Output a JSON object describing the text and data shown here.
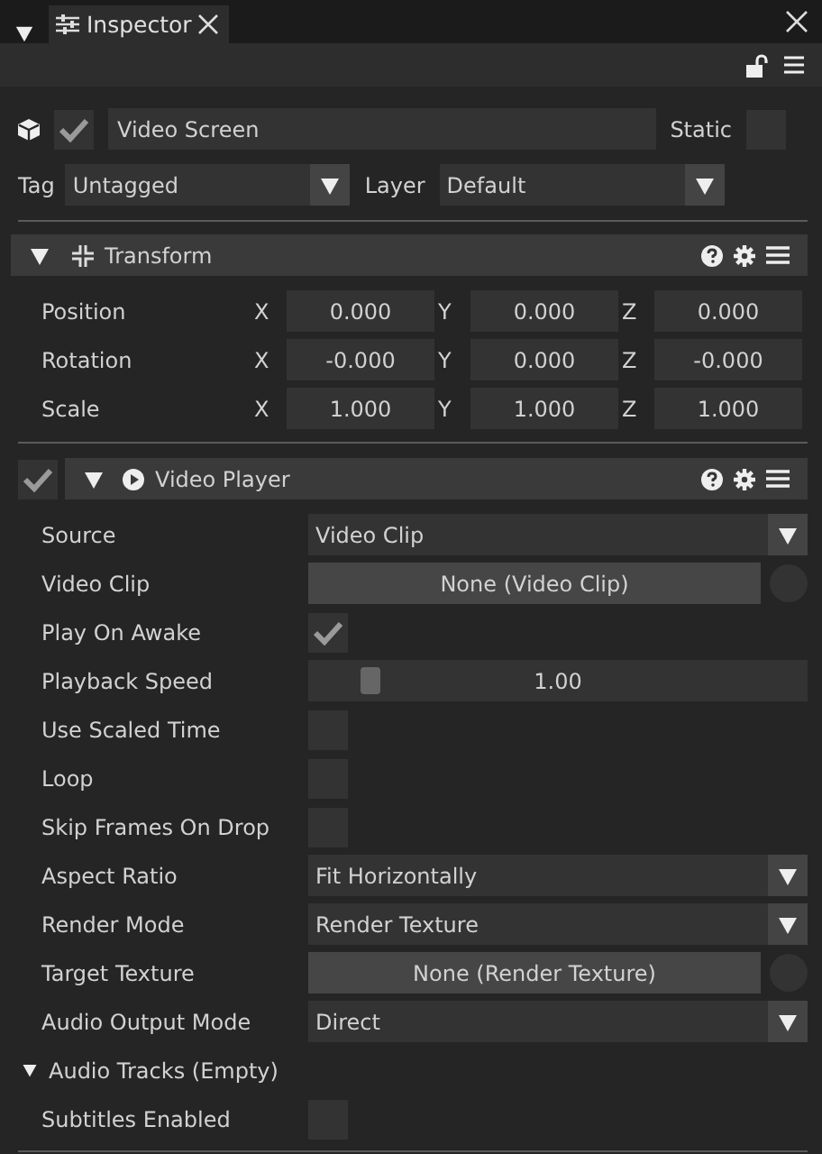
{
  "tab_bar": {
    "tabs": [
      {
        "label": "Inspector",
        "selected": true
      }
    ]
  },
  "object": {
    "active": true,
    "name": "Video Screen",
    "static_label": "Static",
    "static": false,
    "tag_label": "Tag",
    "tag": "Untagged",
    "layer_label": "Layer",
    "layer": "Default"
  },
  "transform": {
    "title": "Transform",
    "expanded": true,
    "rows": [
      {
        "label": "Position",
        "fields": [
          {
            "axis": "X",
            "value": "0.000"
          },
          {
            "axis": "Y",
            "value": "0.000"
          },
          {
            "axis": "Z",
            "value": "0.000"
          }
        ]
      },
      {
        "label": "Rotation",
        "fields": [
          {
            "axis": "X",
            "value": "-0.000"
          },
          {
            "axis": "Y",
            "value": "0.000"
          },
          {
            "axis": "Z",
            "value": "-0.000"
          }
        ]
      },
      {
        "label": "Scale",
        "fields": [
          {
            "axis": "X",
            "value": "1.000"
          },
          {
            "axis": "Y",
            "value": "1.000"
          },
          {
            "axis": "Z",
            "value": "1.000"
          }
        ]
      }
    ]
  },
  "video_player": {
    "title": "Video Player",
    "enabled": true,
    "expanded": true,
    "rows": [
      {
        "kind": "dropdown",
        "label": "Source",
        "value": "Video Clip"
      },
      {
        "kind": "object",
        "label": "Video Clip",
        "value": "None (Video Clip)"
      },
      {
        "kind": "checkbox",
        "label": "Play On Awake",
        "checked": true
      },
      {
        "kind": "slider",
        "label": "Playback Speed",
        "value": "1.00",
        "level": 0.1
      },
      {
        "kind": "checkbox",
        "label": "Use Scaled Time",
        "checked": false
      },
      {
        "kind": "checkbox",
        "label": "Loop",
        "checked": false
      },
      {
        "kind": "checkbox",
        "label": "Skip Frames On Drop",
        "checked": false
      },
      {
        "kind": "dropdown",
        "label": "Aspect Ratio",
        "value": "Fit Horizontally"
      },
      {
        "kind": "dropdown",
        "label": "Render Mode",
        "value": "Render Texture"
      },
      {
        "kind": "object",
        "label": "Target Texture",
        "value": "None (Render Texture)"
      },
      {
        "kind": "dropdown",
        "label": "Audio Output Mode",
        "value": "Direct"
      },
      {
        "kind": "foldout",
        "label": "Audio Tracks (Empty)",
        "expanded": true
      },
      {
        "kind": "checkbox",
        "label": "Subtitles Enabled",
        "checked": false
      }
    ]
  }
}
